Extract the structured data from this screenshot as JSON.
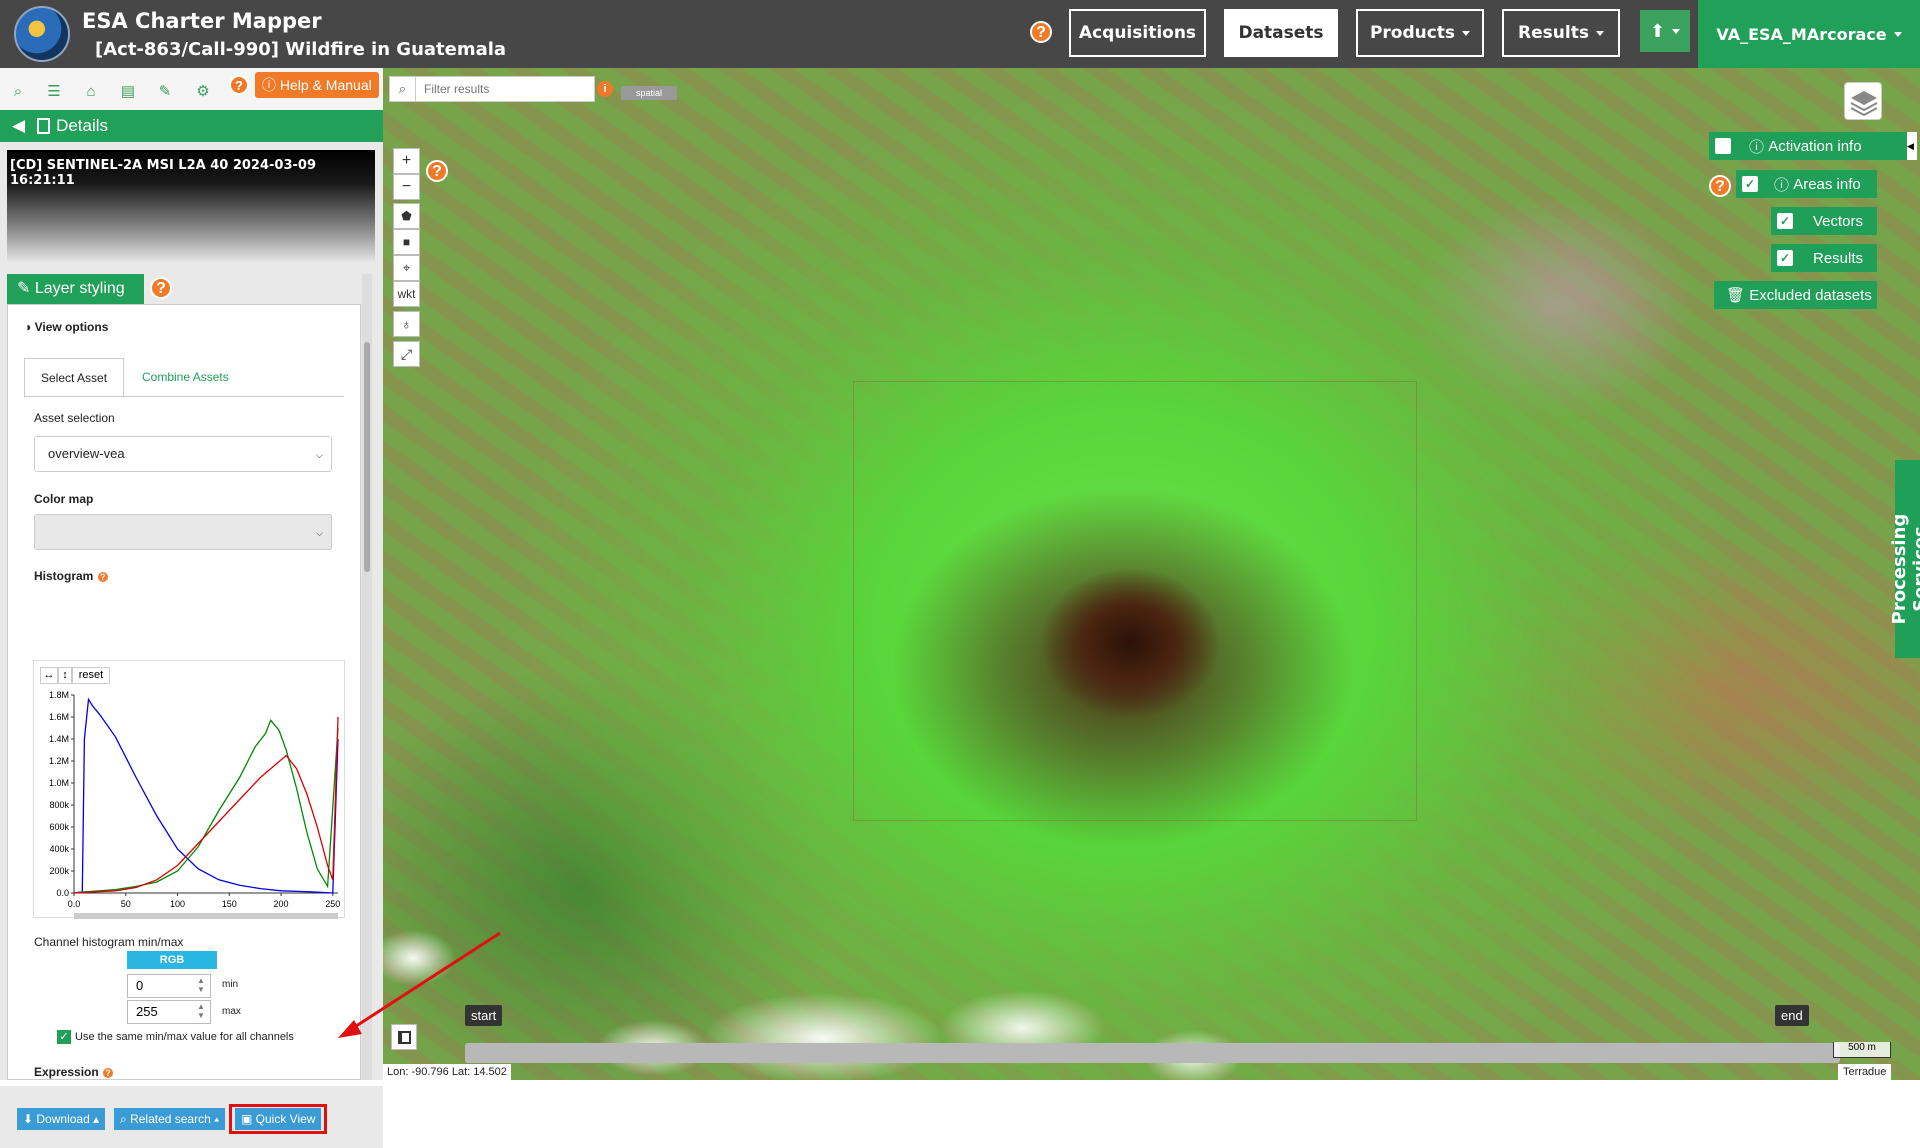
{
  "header": {
    "app_title": "ESA Charter Mapper",
    "activation_title": "[Act-863/Call-990] Wildfire in Guatemala",
    "help": "?",
    "nav": {
      "acquisitions": "Acquisitions",
      "datasets": "Datasets",
      "products": "Products",
      "results": "Results"
    },
    "user": "VA_ESA_MArcorace"
  },
  "left_panel": {
    "help_manual": "Help & Manual",
    "details_label": "Details",
    "dataset_title": "[CD] SENTINEL-2A MSI L2A 40 2024-03-09 16:21:11",
    "layer_styling": "Layer styling",
    "view_options": "View options",
    "tabs": [
      "Select Asset",
      "Combine Assets"
    ],
    "asset_selection_label": "Asset selection",
    "asset_selection_value": "overview-vea",
    "color_map_label": "Color map",
    "color_map_value": "",
    "histogram_label": "Histogram",
    "histogram_reset": "reset",
    "channel_label": "Channel histogram min/max",
    "channel_badge": "RGB",
    "min_value": "0",
    "max_value": "255",
    "min_label": "min",
    "max_label": "max",
    "same_minmax_label": "Use the same min/max value for all channels",
    "expression_label": "Expression",
    "actions": {
      "download": "Download",
      "related_search": "Related search",
      "quick_view": "Quick View"
    }
  },
  "histogram": {
    "y_ticks": [
      "1.8M",
      "1.6M",
      "1.4M",
      "1.2M",
      "1.0M",
      "800k",
      "600k",
      "400k",
      "200k",
      "0.0"
    ],
    "x_ticks": [
      "0.0",
      "50",
      "100",
      "150",
      "200",
      "250"
    ],
    "x_range": [
      0,
      255
    ],
    "y_range": [
      0,
      1800000
    ],
    "series": [
      {
        "color": "#0000ee",
        "points": [
          [
            0,
            0
          ],
          [
            8,
            10000
          ],
          [
            10,
            1400000
          ],
          [
            14,
            1760000
          ],
          [
            18,
            1700000
          ],
          [
            25,
            1620000
          ],
          [
            40,
            1420000
          ],
          [
            60,
            1050000
          ],
          [
            80,
            700000
          ],
          [
            100,
            400000
          ],
          [
            120,
            220000
          ],
          [
            140,
            120000
          ],
          [
            160,
            70000
          ],
          [
            180,
            40000
          ],
          [
            200,
            20000
          ],
          [
            230,
            10000
          ],
          [
            250,
            0
          ],
          [
            255,
            1400000
          ]
        ]
      },
      {
        "color": "#008800",
        "points": [
          [
            0,
            0
          ],
          [
            10,
            10000
          ],
          [
            40,
            30000
          ],
          [
            60,
            60000
          ],
          [
            80,
            100000
          ],
          [
            100,
            200000
          ],
          [
            120,
            420000
          ],
          [
            140,
            750000
          ],
          [
            160,
            1050000
          ],
          [
            175,
            1330000
          ],
          [
            185,
            1450000
          ],
          [
            190,
            1570000
          ],
          [
            198,
            1480000
          ],
          [
            205,
            1300000
          ],
          [
            215,
            950000
          ],
          [
            225,
            550000
          ],
          [
            235,
            220000
          ],
          [
            245,
            60000
          ],
          [
            255,
            1500000
          ]
        ]
      },
      {
        "color": "#dd0000",
        "points": [
          [
            0,
            0
          ],
          [
            10,
            5000
          ],
          [
            40,
            20000
          ],
          [
            60,
            50000
          ],
          [
            80,
            120000
          ],
          [
            100,
            250000
          ],
          [
            120,
            450000
          ],
          [
            140,
            650000
          ],
          [
            160,
            850000
          ],
          [
            180,
            1050000
          ],
          [
            195,
            1170000
          ],
          [
            205,
            1250000
          ],
          [
            215,
            1130000
          ],
          [
            225,
            900000
          ],
          [
            235,
            600000
          ],
          [
            245,
            250000
          ],
          [
            250,
            120000
          ],
          [
            255,
            1600000
          ]
        ]
      }
    ]
  },
  "map": {
    "filter_placeholder": "Filter results",
    "spatial_badge": "spatial",
    "zoom_in": "+",
    "zoom_out": "−",
    "wkt": "wkt",
    "map_help": "?",
    "right": {
      "activation_info": "Activation info",
      "areas_info": "Areas info",
      "vectors": "Vectors",
      "results": "Results",
      "excluded_datasets": "Excluded datasets"
    },
    "processing_services": "Processing Services",
    "timeline_start": "start",
    "timeline_end": "end",
    "coordinates": "Lon: -90.796 Lat: 14.502",
    "scale": "500 m",
    "attribution": "Terradue"
  },
  "colors": {
    "accent_green": "#21a05a",
    "header_bg": "#474747",
    "help_orange": "#f07a28",
    "action_blue": "#3a9bd5",
    "highlight_red": "#e01010"
  }
}
